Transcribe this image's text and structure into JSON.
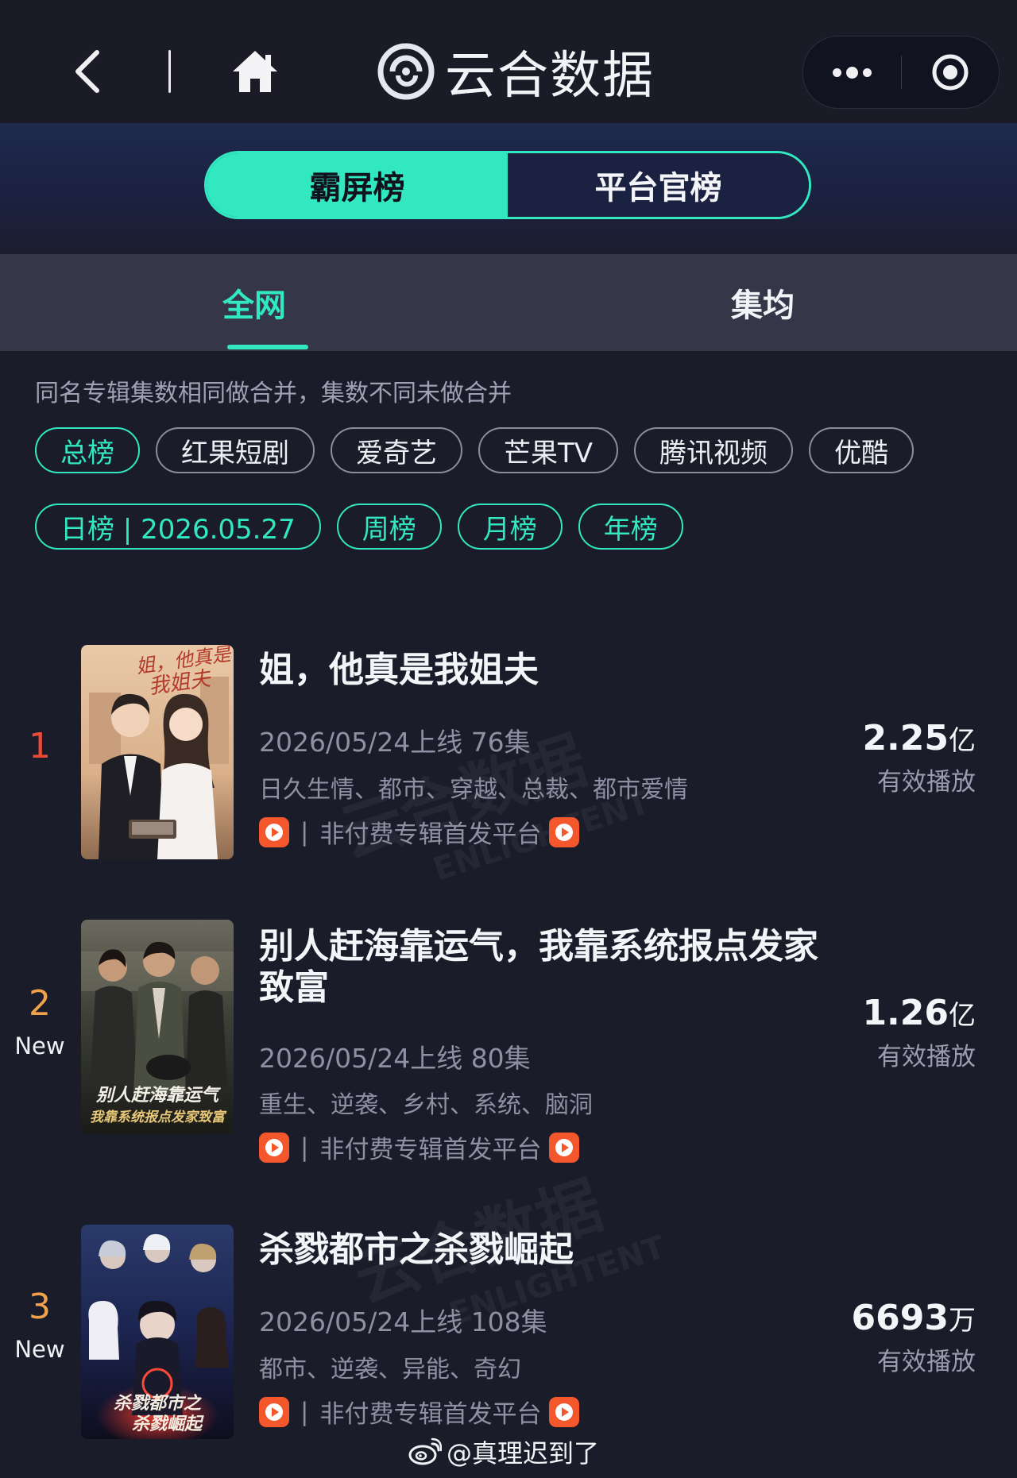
{
  "nav": {
    "back_icon": "chevron-left-icon",
    "home_icon": "home-icon",
    "brand_logo": "yunhe-logo",
    "brand_name": "云合数据",
    "more_icon": "more-dots-icon",
    "close_icon": "target-circle-icon"
  },
  "segment": {
    "tabs": [
      {
        "label": "霸屏榜",
        "active": true
      },
      {
        "label": "平台官榜",
        "active": false
      }
    ]
  },
  "subtabs": [
    {
      "label": "全网",
      "active": true
    },
    {
      "label": "集均",
      "active": false
    }
  ],
  "note": "同名专辑集数相同做合并，集数不同未做合并",
  "platform_chips": [
    {
      "label": "总榜",
      "active": true
    },
    {
      "label": "红果短剧",
      "active": false
    },
    {
      "label": "爱奇艺",
      "active": false
    },
    {
      "label": "芒果TV",
      "active": false
    },
    {
      "label": "腾讯视频",
      "active": false
    },
    {
      "label": "优酷",
      "active": false
    }
  ],
  "period_chips": [
    {
      "label": "日榜 | 2026.05.27",
      "active": true
    },
    {
      "label": "周榜",
      "active": true
    },
    {
      "label": "月榜",
      "active": true
    },
    {
      "label": "年榜",
      "active": true
    }
  ],
  "items": [
    {
      "rank": "1",
      "new": "",
      "title": "姐，他真是我姐夫",
      "poster_text": "姐，他真是我姐夫",
      "meta": "2026/05/24上线 76集",
      "tags": "日久生情、都市、穿越、总裁、都市爱情",
      "platform_text": "非付费专辑首发平台",
      "play_value": "2.25",
      "play_unit": "亿",
      "play_label": "有效播放"
    },
    {
      "rank": "2",
      "new": "New",
      "title": "别人赶海靠运气，我靠系统报点发家致富",
      "poster_text": "别人赶海靠运气 我靠系统报点发家致富",
      "meta": "2026/05/24上线 80集",
      "tags": "重生、逆袭、乡村、系统、脑洞",
      "platform_text": "非付费专辑首发平台",
      "play_value": "1.26",
      "play_unit": "亿",
      "play_label": "有效播放"
    },
    {
      "rank": "3",
      "new": "New",
      "title": "杀戮都市之杀戮崛起",
      "poster_text": "杀戮都市之杀戮崛起",
      "meta": "2026/05/24上线 108集",
      "tags": "都市、逆袭、异能、奇幻",
      "platform_text": "非付费专辑首发平台",
      "play_value": "6693",
      "play_unit": "万",
      "play_label": "有效播放"
    }
  ],
  "watermark": {
    "brand": "云合数据",
    "sub": "ENLIGHTENT"
  },
  "footer": {
    "icon": "weibo-icon",
    "text": "@真理迟到了"
  },
  "colors": {
    "accent": "#32e8c0",
    "rank_first": "#ea4a36",
    "rank_other": "#f0a24a",
    "background": "#1b1c2a"
  }
}
